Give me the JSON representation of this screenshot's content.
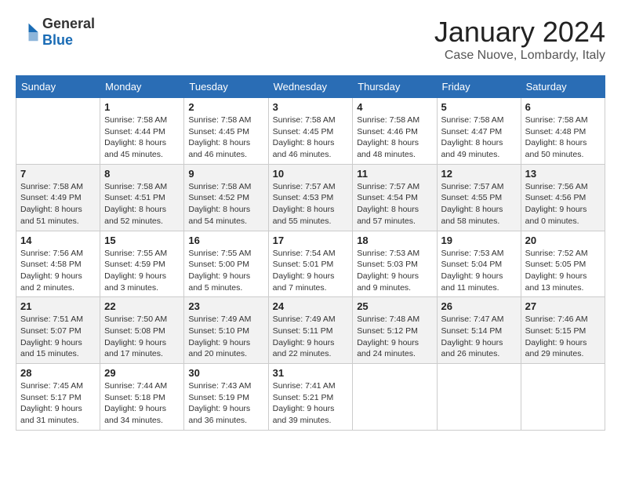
{
  "logo": {
    "general": "General",
    "blue": "Blue"
  },
  "title": "January 2024",
  "location": "Case Nuove, Lombardy, Italy",
  "weekdays": [
    "Sunday",
    "Monday",
    "Tuesday",
    "Wednesday",
    "Thursday",
    "Friday",
    "Saturday"
  ],
  "weeks": [
    [
      {
        "day": "",
        "info": ""
      },
      {
        "day": "1",
        "info": "Sunrise: 7:58 AM\nSunset: 4:44 PM\nDaylight: 8 hours\nand 45 minutes."
      },
      {
        "day": "2",
        "info": "Sunrise: 7:58 AM\nSunset: 4:45 PM\nDaylight: 8 hours\nand 46 minutes."
      },
      {
        "day": "3",
        "info": "Sunrise: 7:58 AM\nSunset: 4:45 PM\nDaylight: 8 hours\nand 46 minutes."
      },
      {
        "day": "4",
        "info": "Sunrise: 7:58 AM\nSunset: 4:46 PM\nDaylight: 8 hours\nand 48 minutes."
      },
      {
        "day": "5",
        "info": "Sunrise: 7:58 AM\nSunset: 4:47 PM\nDaylight: 8 hours\nand 49 minutes."
      },
      {
        "day": "6",
        "info": "Sunrise: 7:58 AM\nSunset: 4:48 PM\nDaylight: 8 hours\nand 50 minutes."
      }
    ],
    [
      {
        "day": "7",
        "info": "Sunrise: 7:58 AM\nSunset: 4:49 PM\nDaylight: 8 hours\nand 51 minutes."
      },
      {
        "day": "8",
        "info": "Sunrise: 7:58 AM\nSunset: 4:51 PM\nDaylight: 8 hours\nand 52 minutes."
      },
      {
        "day": "9",
        "info": "Sunrise: 7:58 AM\nSunset: 4:52 PM\nDaylight: 8 hours\nand 54 minutes."
      },
      {
        "day": "10",
        "info": "Sunrise: 7:57 AM\nSunset: 4:53 PM\nDaylight: 8 hours\nand 55 minutes."
      },
      {
        "day": "11",
        "info": "Sunrise: 7:57 AM\nSunset: 4:54 PM\nDaylight: 8 hours\nand 57 minutes."
      },
      {
        "day": "12",
        "info": "Sunrise: 7:57 AM\nSunset: 4:55 PM\nDaylight: 8 hours\nand 58 minutes."
      },
      {
        "day": "13",
        "info": "Sunrise: 7:56 AM\nSunset: 4:56 PM\nDaylight: 9 hours\nand 0 minutes."
      }
    ],
    [
      {
        "day": "14",
        "info": "Sunrise: 7:56 AM\nSunset: 4:58 PM\nDaylight: 9 hours\nand 2 minutes."
      },
      {
        "day": "15",
        "info": "Sunrise: 7:55 AM\nSunset: 4:59 PM\nDaylight: 9 hours\nand 3 minutes."
      },
      {
        "day": "16",
        "info": "Sunrise: 7:55 AM\nSunset: 5:00 PM\nDaylight: 9 hours\nand 5 minutes."
      },
      {
        "day": "17",
        "info": "Sunrise: 7:54 AM\nSunset: 5:01 PM\nDaylight: 9 hours\nand 7 minutes."
      },
      {
        "day": "18",
        "info": "Sunrise: 7:53 AM\nSunset: 5:03 PM\nDaylight: 9 hours\nand 9 minutes."
      },
      {
        "day": "19",
        "info": "Sunrise: 7:53 AM\nSunset: 5:04 PM\nDaylight: 9 hours\nand 11 minutes."
      },
      {
        "day": "20",
        "info": "Sunrise: 7:52 AM\nSunset: 5:05 PM\nDaylight: 9 hours\nand 13 minutes."
      }
    ],
    [
      {
        "day": "21",
        "info": "Sunrise: 7:51 AM\nSunset: 5:07 PM\nDaylight: 9 hours\nand 15 minutes."
      },
      {
        "day": "22",
        "info": "Sunrise: 7:50 AM\nSunset: 5:08 PM\nDaylight: 9 hours\nand 17 minutes."
      },
      {
        "day": "23",
        "info": "Sunrise: 7:49 AM\nSunset: 5:10 PM\nDaylight: 9 hours\nand 20 minutes."
      },
      {
        "day": "24",
        "info": "Sunrise: 7:49 AM\nSunset: 5:11 PM\nDaylight: 9 hours\nand 22 minutes."
      },
      {
        "day": "25",
        "info": "Sunrise: 7:48 AM\nSunset: 5:12 PM\nDaylight: 9 hours\nand 24 minutes."
      },
      {
        "day": "26",
        "info": "Sunrise: 7:47 AM\nSunset: 5:14 PM\nDaylight: 9 hours\nand 26 minutes."
      },
      {
        "day": "27",
        "info": "Sunrise: 7:46 AM\nSunset: 5:15 PM\nDaylight: 9 hours\nand 29 minutes."
      }
    ],
    [
      {
        "day": "28",
        "info": "Sunrise: 7:45 AM\nSunset: 5:17 PM\nDaylight: 9 hours\nand 31 minutes."
      },
      {
        "day": "29",
        "info": "Sunrise: 7:44 AM\nSunset: 5:18 PM\nDaylight: 9 hours\nand 34 minutes."
      },
      {
        "day": "30",
        "info": "Sunrise: 7:43 AM\nSunset: 5:19 PM\nDaylight: 9 hours\nand 36 minutes."
      },
      {
        "day": "31",
        "info": "Sunrise: 7:41 AM\nSunset: 5:21 PM\nDaylight: 9 hours\nand 39 minutes."
      },
      {
        "day": "",
        "info": ""
      },
      {
        "day": "",
        "info": ""
      },
      {
        "day": "",
        "info": ""
      }
    ]
  ]
}
